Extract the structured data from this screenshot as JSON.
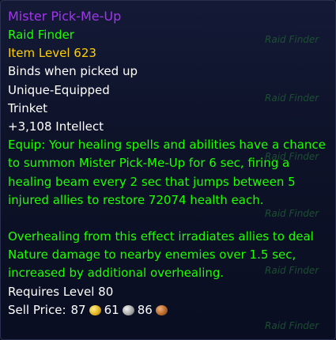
{
  "item": {
    "name": "Mister Pick-Me-Up",
    "source": "Raid Finder",
    "item_level": "Item Level 623",
    "bind": "Binds when picked up",
    "unique": "Unique-Equipped",
    "slot": "Trinket",
    "stat": "+3,108 Intellect",
    "equip_text": "Equip: Your healing spells and abilities have a chance to summon Mister Pick-Me-Up for 6 sec, firing a healing beam every 2 sec that jumps between 5 injured allies to restore 72074 health each.",
    "overheal_text": "Overhealing from this effect irradiates allies to deal Nature damage to nearby enemies over 1.5 sec, increased by additional overhealing.",
    "requires": "Requires Level 80",
    "sell_label": "Sell Price:",
    "sell_gold": "87",
    "sell_silver": "61",
    "sell_copper": "86"
  },
  "watermark": {
    "text": "Raid Finder"
  },
  "colors": {
    "epic": "#a335ee",
    "uncommon": "#1eff00",
    "item_level": "#ffd100",
    "text": "#ffffff"
  },
  "icons": [
    "gold-coin-icon",
    "silver-coin-icon",
    "copper-coin-icon"
  ]
}
